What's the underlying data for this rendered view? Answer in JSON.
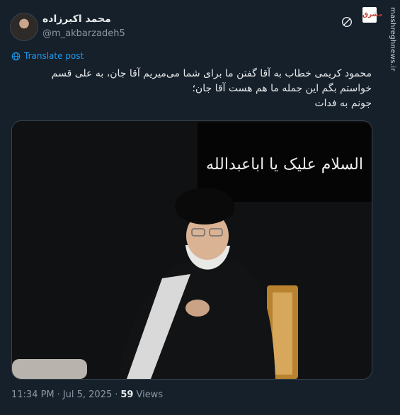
{
  "author": {
    "display_name": "محمد اکبرزاده",
    "handle": "@m_akbarzadeh5"
  },
  "site": {
    "logo_text": "مشرق",
    "watermark": "mashreghnews.ir"
  },
  "translate_label": "Translate post",
  "tweet": {
    "lines": [
      "محمود کریمی خطاب به آقا گفتن ما برای شما می‌میریم آقا جان، به علی قسم",
      "خواستم بگم این جمله ما هم هست آقا جان؛",
      "جونم به فدات"
    ]
  },
  "media": {
    "banner_text": "السلام علیک یا اباعبدالله"
  },
  "meta": {
    "time": "11:34 PM",
    "separator": "·",
    "date": "Jul 5, 2025",
    "views_count": "59",
    "views_label": "Views"
  },
  "icons": {
    "translate": "globe-icon",
    "x_logo": "x-icon",
    "avatar": "profile-avatar"
  },
  "colors": {
    "background": "#15202b",
    "link": "#1d9bf0",
    "muted": "#8b98a5",
    "text": "#e7e9ea"
  }
}
